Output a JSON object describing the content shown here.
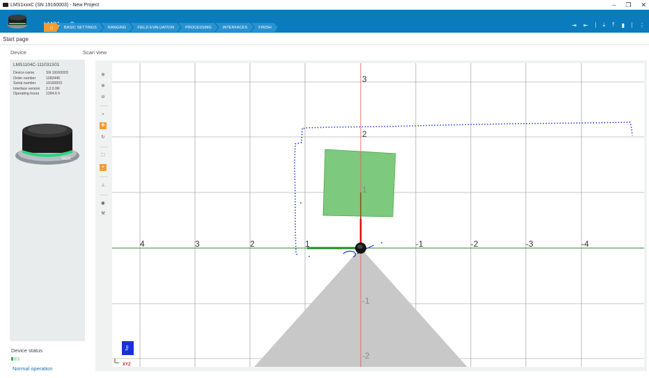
{
  "window": {
    "title": "LMS1xxxC (SN 19160003) - New Project",
    "controls": [
      "–",
      "❐",
      "✕"
    ]
  },
  "header": {
    "device_title": "LMS1xxxC",
    "home_icon": "home-icon",
    "steps": [
      "BASIC SETTINGS",
      "RANGING",
      "FIELD EVALUATION",
      "PROCESSING",
      "INTERFACES",
      "FINISH"
    ],
    "actions": [
      "login-icon",
      "logout-icon",
      "download-icon",
      "upload-icon",
      "trash-icon",
      "more-icon"
    ]
  },
  "page": {
    "breadcrumb": "Start page",
    "device_section": "Device",
    "scan_section": "Scan view"
  },
  "device": {
    "model": "LMS1104C-111031S01",
    "info": [
      {
        "key": "Device name",
        "value": "SN 19160003"
      },
      {
        "key": "Order number",
        "value": "1092445"
      },
      {
        "key": "Serial number",
        "value": "19160003"
      },
      {
        "key": "Interface version",
        "value": "2.2.0.0R"
      },
      {
        "key": "Operating hours",
        "value": "1394.6 h"
      }
    ],
    "brand": "SICK"
  },
  "status": {
    "title": "Device status",
    "text": "Normal operation",
    "level": 0.33
  },
  "scan_view": {
    "toolbar": [
      {
        "icon": "zoom-in-icon",
        "active": false
      },
      {
        "icon": "zoom-in-icon",
        "active": false
      },
      {
        "icon": "zoom-out-icon",
        "active": false
      },
      {
        "icon": "magnifier-icon",
        "active": false
      },
      {
        "icon": "pan-icon",
        "active": true
      },
      {
        "icon": "rotate-icon",
        "active": false
      },
      {
        "icon": "fit-view-icon",
        "active": false
      },
      {
        "icon": "center-icon",
        "active": true
      },
      {
        "icon": "axes-icon",
        "active": false
      },
      {
        "icon": "eye-icon",
        "active": false
      },
      {
        "icon": "wrench-icon",
        "active": false
      }
    ],
    "x_ticks": [
      "4",
      "3",
      "2",
      "1",
      "-1",
      "-2",
      "-3",
      "-4"
    ],
    "y_ticks": [
      "3",
      "2",
      "1",
      "-1",
      "-2"
    ],
    "top_button": "Top",
    "axis_label": "XYZ",
    "colors": {
      "grid": "#8d9090",
      "x_axis": "#2c8a2c",
      "y_axis": "#e06060",
      "field": "#7dc97d",
      "cone": "#c8c8c8",
      "points": "#1a2fd0"
    }
  }
}
